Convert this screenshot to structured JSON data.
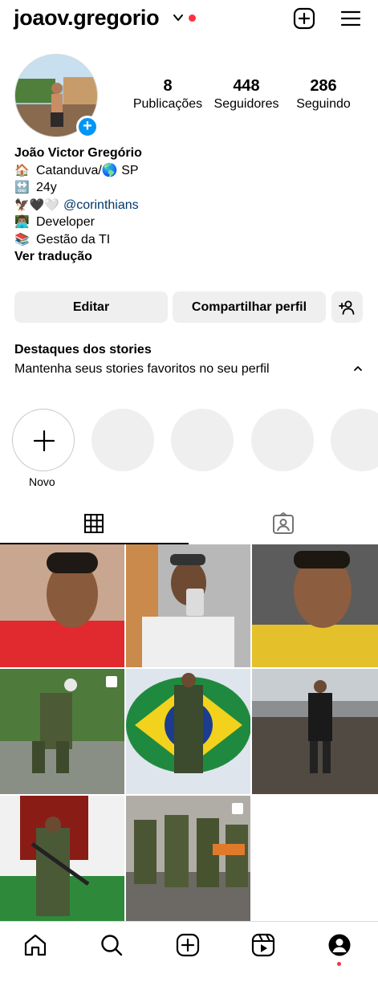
{
  "header": {
    "username": "joaov.gregorio",
    "icons": [
      "chevron-down-icon",
      "new-post-icon",
      "menu-icon"
    ],
    "notification_color": "#ff3040"
  },
  "profile": {
    "stats": [
      {
        "value": "8",
        "label": "Publicações"
      },
      {
        "value": "448",
        "label": "Seguidores"
      },
      {
        "value": "286",
        "label": "Seguindo"
      }
    ],
    "name": "João Victor Gregório",
    "bio": [
      {
        "emoji": "🏠",
        "text": "Catanduva/🌎 SP"
      },
      {
        "emoji": "🔛",
        "text": "24y"
      },
      {
        "emoji": "🦅🖤🤍",
        "text": "@corinthians"
      },
      {
        "emoji": "👨🏽‍💻",
        "text": "Developer"
      },
      {
        "emoji": "📚",
        "text": "Gestão da TI"
      }
    ],
    "see_translation": "Ver tradução"
  },
  "buttons": {
    "edit": "Editar",
    "share": "Compartilhar perfil",
    "discover_icon": "add-person-icon"
  },
  "highlights": {
    "title": "Destaques dos stories",
    "subtitle": "Mantenha seus stories favoritos no seu perfil",
    "new_label": "Novo"
  },
  "tabs": [
    {
      "name": "grid-icon",
      "active": true
    },
    {
      "name": "tagged-icon",
      "active": false
    }
  ],
  "posts_count": 8,
  "bottom_nav": [
    "home-icon",
    "search-icon",
    "create-icon",
    "reels-icon",
    "profile-icon"
  ],
  "colors": {
    "accent": "#0095f6",
    "button_bg": "#efefef",
    "mention": "#00376b"
  }
}
